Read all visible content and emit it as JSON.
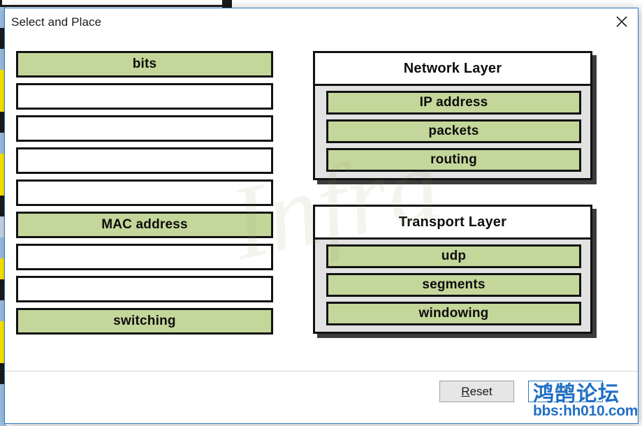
{
  "dialog": {
    "title": "Select and Place",
    "close_icon": "close-icon"
  },
  "drag_bank": {
    "items": [
      {
        "label": "bits",
        "state": "filled"
      },
      {
        "label": "",
        "state": "empty"
      },
      {
        "label": "",
        "state": "empty"
      },
      {
        "label": "",
        "state": "empty"
      },
      {
        "label": "",
        "state": "empty"
      },
      {
        "label": "MAC address",
        "state": "filled"
      },
      {
        "label": "",
        "state": "empty"
      },
      {
        "label": "",
        "state": "empty"
      },
      {
        "label": "switching",
        "state": "filled"
      }
    ]
  },
  "panels": [
    {
      "title": "Network Layer",
      "slots": [
        {
          "label": "IP address"
        },
        {
          "label": "packets"
        },
        {
          "label": "routing"
        }
      ]
    },
    {
      "title": "Transport Layer",
      "slots": [
        {
          "label": "udp"
        },
        {
          "label": "segments"
        },
        {
          "label": "windowing"
        }
      ]
    }
  ],
  "footer": {
    "reset_accel": "R",
    "reset_rest": "eset",
    "ok_label": "OK"
  },
  "watermarks": {
    "center": "Infra",
    "forum_cn": "鸿鹄论坛",
    "forum_url": "bbs:hh010.com"
  },
  "colors": {
    "tile_green": "#c4d79b",
    "tile_border": "#121212",
    "panel_bg": "#e2e2e2",
    "dialog_border": "#2a7ac0",
    "watermark_blue": "#1f6fc4"
  },
  "background_strip": {
    "rows": [
      "#9cc0e3",
      "#1b1b1b",
      "#9cc0e3",
      "#ffe800",
      "#ffe800",
      "#1b1b1b",
      "#9cc0e3",
      "#ffe800",
      "#ffe800",
      "#1b1b1b",
      "#c8d8e8",
      "#9cc0e3",
      "#ffe800",
      "#1b1b1b",
      "#9cc0e3",
      "#ffe800",
      "#ffe800",
      "#1b1b1b",
      "#9cc0e3",
      "#9cc0e3"
    ]
  }
}
